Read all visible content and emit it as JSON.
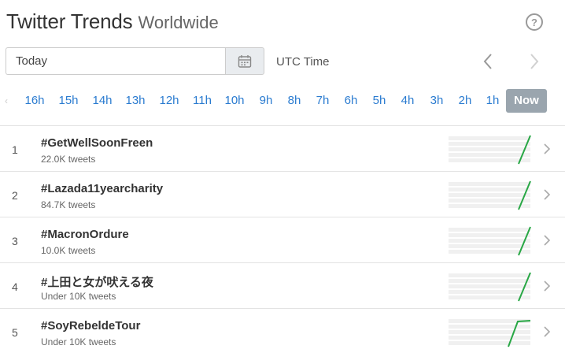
{
  "header": {
    "title": "Twitter Trends",
    "subtitle": "Worldwide",
    "help_icon_glyph": "?"
  },
  "date_picker": {
    "value": "Today",
    "timezone_label": "UTC Time"
  },
  "hours": [
    "16h",
    "15h",
    "14h",
    "13h",
    "12h",
    "11h",
    "10h",
    "9h",
    "8h",
    "7h",
    "6h",
    "5h",
    "4h",
    "3h",
    "2h",
    "1h"
  ],
  "hour_now_label": "Now",
  "colors": {
    "link": "#2a7bd0",
    "active_pill": "#9aa5ae",
    "spark_line": "#28a745",
    "spark_bg": "#f0f0f0"
  },
  "trends": [
    {
      "rank": "1",
      "tag": "#GetWellSoonFreen",
      "tweets": "22.0K tweets",
      "trend_shape": "rising"
    },
    {
      "rank": "2",
      "tag": "#Lazada11yearcharity",
      "tweets": "84.7K tweets",
      "trend_shape": "rising"
    },
    {
      "rank": "3",
      "tag": "#MacronOrdure",
      "tweets": "10.0K tweets",
      "trend_shape": "rising"
    },
    {
      "rank": "4",
      "tag": "#上田と女が吠える夜",
      "tweets": "Under 10K tweets",
      "trend_shape": "rising"
    },
    {
      "rank": "5",
      "tag": "#SoyRebeldeTour",
      "tweets": "Under 10K tweets",
      "trend_shape": "rising-plateau"
    }
  ]
}
